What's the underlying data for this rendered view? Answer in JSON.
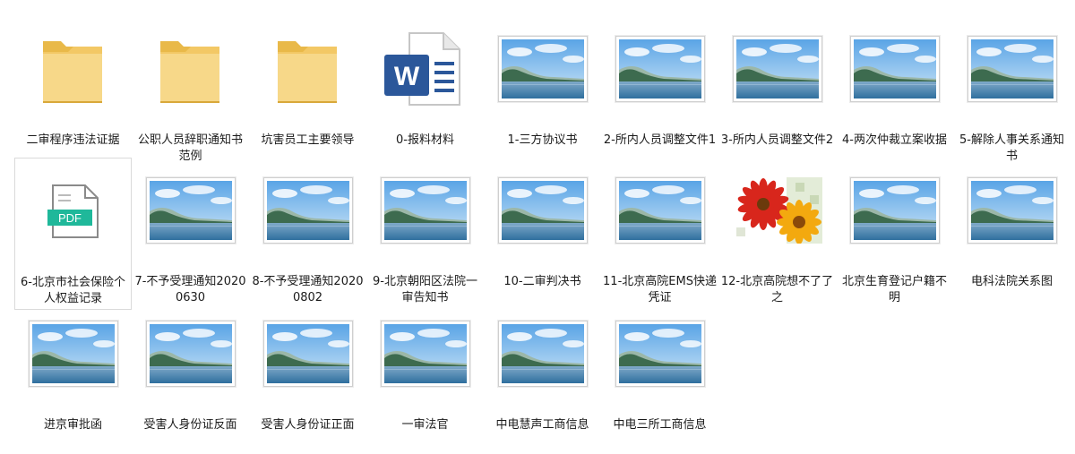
{
  "files": [
    {
      "name": "二审程序违法证据",
      "type": "folder"
    },
    {
      "name": "公职人员辞职通知书范例",
      "type": "folder"
    },
    {
      "name": "坑害员工主要领导",
      "type": "folder"
    },
    {
      "name": "0-报料材料",
      "type": "word"
    },
    {
      "name": "1-三方协议书",
      "type": "image"
    },
    {
      "name": "2-所内人员调整文件1",
      "type": "image"
    },
    {
      "name": "3-所内人员调整文件2",
      "type": "image"
    },
    {
      "name": "4-两次仲裁立案收据",
      "type": "image"
    },
    {
      "name": "5-解除人事关系通知书",
      "type": "image"
    },
    {
      "name": "6-北京市社会保险个人权益记录",
      "type": "pdf"
    },
    {
      "name": "7-不予受理通知20200630",
      "type": "image"
    },
    {
      "name": "8-不予受理通知20200802",
      "type": "image"
    },
    {
      "name": "9-北京朝阳区法院一审告知书",
      "type": "image"
    },
    {
      "name": "10-二审判决书",
      "type": "image"
    },
    {
      "name": "11-北京高院EMS快递凭证",
      "type": "image"
    },
    {
      "name": "12-北京高院想不了了之",
      "type": "flower"
    },
    {
      "name": "北京生育登记户籍不明",
      "type": "image"
    },
    {
      "name": "电科法院关系图",
      "type": "image"
    },
    {
      "name": "进京审批函",
      "type": "image"
    },
    {
      "name": "受害人身份证反面",
      "type": "image"
    },
    {
      "name": "受害人身份证正面",
      "type": "image"
    },
    {
      "name": "一审法官",
      "type": "image"
    },
    {
      "name": "中电慧声工商信息",
      "type": "image"
    },
    {
      "name": "中电三所工商信息",
      "type": "image"
    }
  ],
  "icons": {
    "word_letter": "W",
    "pdf_label": "PDF"
  },
  "colors": {
    "folder": "#f5d27a",
    "word": "#2b579a",
    "pdf": "#1fb89a"
  }
}
